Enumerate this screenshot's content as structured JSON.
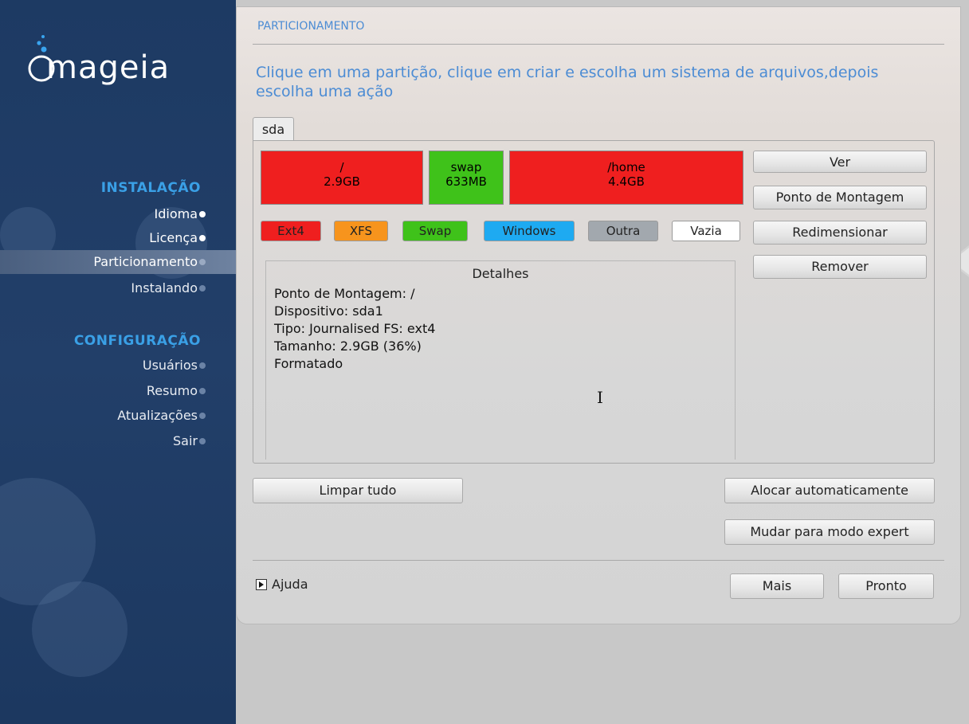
{
  "brand": {
    "logo_text": "mageia"
  },
  "sidebar": {
    "sections": [
      {
        "title": "INSTALAÇÃO",
        "items": [
          {
            "label": "Idioma",
            "state": "done"
          },
          {
            "label": "Licença",
            "state": "done"
          },
          {
            "label": "Particionamento",
            "state": "active"
          },
          {
            "label": "Instalando",
            "state": "pending"
          }
        ]
      },
      {
        "title": "CONFIGURAÇÃO",
        "items": [
          {
            "label": "Usuários",
            "state": "pending"
          },
          {
            "label": "Resumo",
            "state": "pending"
          },
          {
            "label": "Atualizações",
            "state": "pending"
          },
          {
            "label": "Sair",
            "state": "pending"
          }
        ]
      }
    ]
  },
  "panel": {
    "title": "PARTICIONAMENTO",
    "instruction": "Clique em uma partição, clique em criar e escolha um sistema de arquivos,depois escolha uma ação",
    "disk_tab": "sda",
    "partitions": [
      {
        "name": "/",
        "size": "2.9GB",
        "color": "#ef1f1f",
        "type": "Ext4"
      },
      {
        "name": "swap",
        "size": "633MB",
        "color": "#3fc21a",
        "type": "Swap"
      },
      {
        "name": "/home",
        "size": "4.4GB",
        "color": "#ef1f1f",
        "type": "Ext4"
      }
    ],
    "legend": [
      {
        "label": "Ext4",
        "color": "#ef1f1f"
      },
      {
        "label": "XFS",
        "color": "#f7941d"
      },
      {
        "label": "Swap",
        "color": "#3fc21a"
      },
      {
        "label": "Windows",
        "color": "#1eaaf1"
      },
      {
        "label": "Outra",
        "color": "#a2a8ae"
      },
      {
        "label": "Vazia",
        "color": "#ffffff"
      }
    ],
    "actions": {
      "view": "Ver",
      "mount_point": "Ponto de Montagem",
      "resize": "Redimensionar",
      "remove": "Remover"
    },
    "details": {
      "title": "Detalhes",
      "lines": [
        "Ponto de Montagem: /",
        "Dispositivo: sda1",
        "Tipo: Journalised FS: ext4",
        "Tamanho: 2.9GB (36%)",
        "Formatado"
      ]
    },
    "clear_all": "Limpar tudo",
    "auto_allocate": "Alocar automaticamente",
    "expert_mode": "Mudar para modo expert",
    "help": "Ajuda",
    "more": "Mais",
    "done": "Pronto"
  }
}
